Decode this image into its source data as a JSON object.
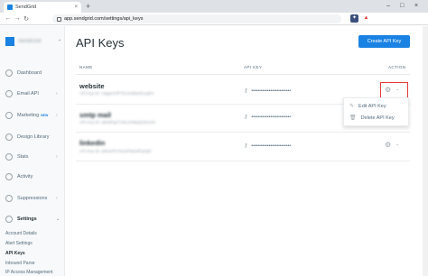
{
  "browser": {
    "tab_title": "SendGrid",
    "tab_close": "×",
    "new_tab": "+",
    "win_minimize": "–",
    "win_maximize": "□",
    "win_close": "×",
    "back": "←",
    "forward": "→",
    "reload": "↻",
    "url": "app.sendgrid.com/settings/api_keys",
    "ext1": "✦",
    "ext2": "▲"
  },
  "sidebar": {
    "account_name": "SendGrid",
    "account_chevron": "⌄",
    "items": [
      {
        "label": "Dashboard"
      },
      {
        "label": "Email API",
        "caret": "›"
      },
      {
        "label": "Marketing",
        "badge": "NEW",
        "caret": "›"
      },
      {
        "label": "Design Library"
      },
      {
        "label": "Stats",
        "caret": "›"
      },
      {
        "label": "Activity"
      },
      {
        "label": "Suppressions",
        "caret": "›"
      },
      {
        "label": "Settings",
        "caret": "⌄"
      }
    ],
    "sub_items": [
      {
        "label": "Account Details"
      },
      {
        "label": "Alert Settings"
      },
      {
        "label": "API Keys"
      },
      {
        "label": "Inbound Parse"
      },
      {
        "label": "IP Access Management"
      }
    ]
  },
  "main": {
    "title": "API Keys",
    "create_button": "Create API Key",
    "columns": {
      "name": "NAME",
      "api_key": "API KEY",
      "action": "ACTION"
    },
    "rows": [
      {
        "name": "website",
        "id": "API Key ID: ndpgHCfPTk1XnBlw3GoqRA",
        "mask": "•••••••••••••••••••••••••"
      },
      {
        "name": "smtp mail",
        "id": "API Key ID: aB3dFgH7JkLmN9pQrStUvW",
        "mask": "•••••••••••••••••••••••••"
      },
      {
        "name": "linkedin",
        "id": "API Key ID: qW2eRtY6uIoP8aSdFgHjKl",
        "mask": "•••••••••••••••••••••••••"
      }
    ],
    "key_icon": "⚷",
    "gear_icon": "⚙",
    "chevron_icon": "⌄",
    "dropdown": {
      "edit": "Edit API Key",
      "delete": "Delete API Key",
      "edit_icon": "✎",
      "delete_icon": "🗑"
    }
  }
}
